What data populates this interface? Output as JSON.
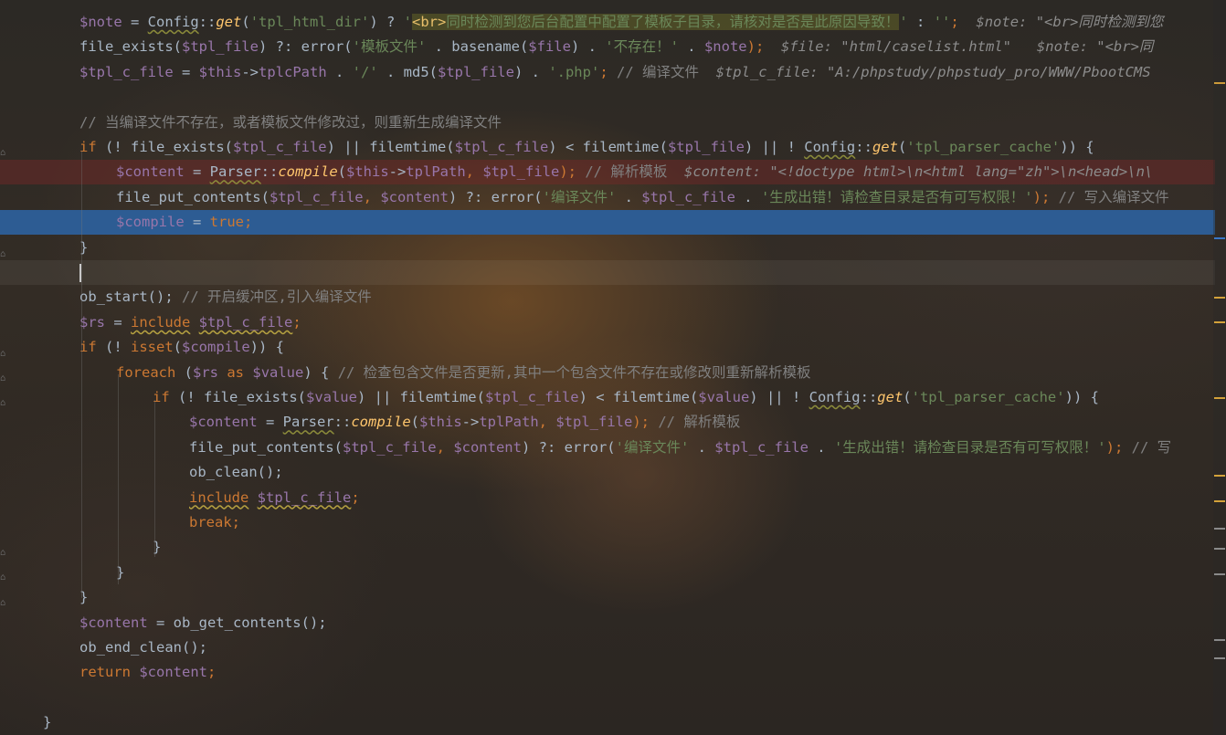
{
  "editor": {
    "lines": [
      {
        "segs": [
          [
            "$note",
            "v"
          ],
          [
            " = ",
            ""
          ],
          [
            "Config",
            "cls"
          ],
          [
            "::",
            ""
          ],
          [
            "get",
            "f"
          ],
          [
            "(",
            ""
          ],
          [
            "'tpl_html_dir'",
            "s"
          ],
          [
            ") ? ",
            ""
          ],
          [
            "'",
            "s"
          ],
          [
            "<br>",
            "tag"
          ],
          [
            "同时检测到您后台配置中配置了模板子目录，请核对是否是此原因导致！",
            "tagtext"
          ],
          [
            "'",
            "s"
          ],
          [
            " : ",
            ""
          ],
          [
            "''",
            "s"
          ],
          [
            ";",
            "p"
          ],
          [
            "  $note: \"<br>同时检测到您",
            "hint"
          ]
        ]
      },
      {
        "segs": [
          [
            "file_exists(",
            ""
          ],
          [
            "$tpl_file",
            "v"
          ],
          [
            ") ?: error(",
            ""
          ],
          [
            "'模板文件'",
            "s"
          ],
          [
            " . basename(",
            ""
          ],
          [
            "$file",
            "v"
          ],
          [
            ") . ",
            ""
          ],
          [
            "'不存在！'",
            "s"
          ],
          [
            " . ",
            ""
          ],
          [
            "$note",
            "v"
          ],
          [
            ");",
            "p"
          ],
          [
            "  $file: \"html/caselist.html\"   $note: \"<br>同",
            "hint"
          ]
        ]
      },
      {
        "segs": [
          [
            "$tpl_c_file",
            "v"
          ],
          [
            " = ",
            ""
          ],
          [
            "$this",
            "v"
          ],
          [
            "->",
            ""
          ],
          [
            "tplcPath",
            "v"
          ],
          [
            " . ",
            ""
          ],
          [
            "'/'",
            "s"
          ],
          [
            " . md5(",
            ""
          ],
          [
            "$tpl_file",
            "v"
          ],
          [
            ") . ",
            ""
          ],
          [
            "'.php'",
            "s"
          ],
          [
            "; ",
            "p"
          ],
          [
            "// 编译文件",
            "c"
          ],
          [
            "  $tpl_c_file: \"A:/phpstudy/phpstudy_pro/WWW/PbootCMS",
            "hint"
          ]
        ]
      },
      {
        "segs": []
      },
      {
        "segs": [
          [
            "// 当编译文件不存在，或者模板文件修改过，则重新生成编译文件",
            "c"
          ]
        ]
      },
      {
        "segs": [
          [
            "if",
            "k"
          ],
          [
            " (! file_exists(",
            ""
          ],
          [
            "$tpl_c_file",
            "v"
          ],
          [
            ") || filemtime(",
            ""
          ],
          [
            "$tpl_c_file",
            "v"
          ],
          [
            ") < filemtime(",
            ""
          ],
          [
            "$tpl_file",
            "v"
          ],
          [
            ") || ! ",
            ""
          ],
          [
            "Config",
            "cls"
          ],
          [
            "::",
            ""
          ],
          [
            "get",
            "f"
          ],
          [
            "(",
            ""
          ],
          [
            "'tpl_parser_cache'",
            "s"
          ],
          [
            ")) {",
            ""
          ]
        ]
      },
      {
        "segs": [
          [
            "$content",
            "v"
          ],
          [
            " = ",
            ""
          ],
          [
            "Parser",
            "cls"
          ],
          [
            "::",
            ""
          ],
          [
            "compile",
            "f"
          ],
          [
            "(",
            ""
          ],
          [
            "$this",
            "v"
          ],
          [
            "->",
            ""
          ],
          [
            "tplPath",
            "v"
          ],
          [
            ", ",
            "p"
          ],
          [
            "$tpl_file",
            "v"
          ],
          [
            "); ",
            "p"
          ],
          [
            "// 解析模板",
            "c"
          ],
          [
            "  $content: \"<!doctype html>\\n<html lang=\"zh\">\\n<head>\\n\\",
            "hint"
          ]
        ]
      },
      {
        "segs": [
          [
            "file_put_contents(",
            ""
          ],
          [
            "$tpl_c_file",
            "v"
          ],
          [
            ", ",
            "p"
          ],
          [
            "$content",
            "v"
          ],
          [
            ") ?: error(",
            ""
          ],
          [
            "'编译文件'",
            "s"
          ],
          [
            " . ",
            ""
          ],
          [
            "$tpl_c_file",
            "v"
          ],
          [
            " . ",
            ""
          ],
          [
            "'生成出错！请检查目录是否有可写权限！'",
            "s"
          ],
          [
            "); ",
            "p"
          ],
          [
            "// 写入编译文件",
            "c"
          ]
        ]
      },
      {
        "segs": [
          [
            "$compile",
            "v"
          ],
          [
            " = ",
            ""
          ],
          [
            "true",
            "k"
          ],
          [
            ";",
            "p"
          ]
        ]
      },
      {
        "segs": [
          [
            "}",
            ""
          ]
        ]
      },
      {
        "segs": []
      },
      {
        "segs": [
          [
            "ob_start(); ",
            ""
          ],
          [
            "// 开启缓冲区,引入编译文件",
            "c"
          ]
        ]
      },
      {
        "segs": [
          [
            "$rs",
            "v"
          ],
          [
            " = ",
            ""
          ],
          [
            "include",
            "uline k"
          ],
          [
            " ",
            ""
          ],
          [
            "$tpl_c_file",
            "uline v"
          ],
          [
            ";",
            "p"
          ]
        ]
      },
      {
        "segs": [
          [
            "if",
            "k"
          ],
          [
            " (! ",
            ""
          ],
          [
            "isset",
            "k"
          ],
          [
            "(",
            ""
          ],
          [
            "$compile",
            "v"
          ],
          [
            ")) {",
            ""
          ]
        ]
      },
      {
        "segs": [
          [
            "foreach",
            "k"
          ],
          [
            " (",
            ""
          ],
          [
            "$rs",
            "v"
          ],
          [
            " ",
            ""
          ],
          [
            "as",
            "k"
          ],
          [
            " ",
            ""
          ],
          [
            "$value",
            "v"
          ],
          [
            ") { ",
            ""
          ],
          [
            "// 检查包含文件是否更新,其中一个包含文件不存在或修改则重新解析模板",
            "c"
          ]
        ]
      },
      {
        "segs": [
          [
            "if",
            "k"
          ],
          [
            " (! file_exists(",
            ""
          ],
          [
            "$value",
            "v"
          ],
          [
            ") || filemtime(",
            ""
          ],
          [
            "$tpl_c_file",
            "v"
          ],
          [
            ") < filemtime(",
            ""
          ],
          [
            "$value",
            "v"
          ],
          [
            ") || ! ",
            ""
          ],
          [
            "Config",
            "cls"
          ],
          [
            "::",
            ""
          ],
          [
            "get",
            "f"
          ],
          [
            "(",
            ""
          ],
          [
            "'tpl_parser_cache'",
            "s"
          ],
          [
            ")) {",
            ""
          ]
        ]
      },
      {
        "segs": [
          [
            "$content",
            "v"
          ],
          [
            " = ",
            ""
          ],
          [
            "Parser",
            "cls"
          ],
          [
            "::",
            ""
          ],
          [
            "compile",
            "f"
          ],
          [
            "(",
            ""
          ],
          [
            "$this",
            "v"
          ],
          [
            "->",
            ""
          ],
          [
            "tplPath",
            "v"
          ],
          [
            ", ",
            "p"
          ],
          [
            "$tpl_file",
            "v"
          ],
          [
            "); ",
            "p"
          ],
          [
            "// 解析模板",
            "c"
          ]
        ]
      },
      {
        "segs": [
          [
            "file_put_contents(",
            ""
          ],
          [
            "$tpl_c_file",
            "v"
          ],
          [
            ", ",
            "p"
          ],
          [
            "$content",
            "v"
          ],
          [
            ") ?: error(",
            ""
          ],
          [
            "'编译文件'",
            "s"
          ],
          [
            " . ",
            ""
          ],
          [
            "$tpl_c_file",
            "v"
          ],
          [
            " . ",
            ""
          ],
          [
            "'生成出错！请检查目录是否有可写权限！'",
            "s"
          ],
          [
            "); ",
            "p"
          ],
          [
            "// 写",
            "c"
          ]
        ]
      },
      {
        "segs": [
          [
            "ob_clean();",
            ""
          ]
        ]
      },
      {
        "segs": [
          [
            "include",
            "uline k"
          ],
          [
            " ",
            ""
          ],
          [
            "$tpl_c_file",
            "uline v"
          ],
          [
            ";",
            "p"
          ]
        ]
      },
      {
        "segs": [
          [
            "break",
            "k"
          ],
          [
            ";",
            "p"
          ]
        ]
      },
      {
        "segs": [
          [
            "}",
            ""
          ]
        ]
      },
      {
        "segs": [
          [
            "}",
            ""
          ]
        ]
      },
      {
        "segs": [
          [
            "}",
            ""
          ]
        ]
      },
      {
        "segs": [
          [
            "$content",
            "v"
          ],
          [
            " = ob_get_contents();",
            ""
          ]
        ]
      },
      {
        "segs": [
          [
            "ob_end_clean();",
            ""
          ]
        ]
      },
      {
        "segs": [
          [
            "return",
            "k"
          ],
          [
            " ",
            ""
          ],
          [
            "$content",
            "v"
          ],
          [
            ";",
            "p"
          ]
        ]
      },
      {
        "segs": []
      },
      {
        "segs": [
          [
            "}",
            ""
          ]
        ]
      }
    ]
  },
  "colors": {
    "background": "#2b2b2b",
    "variable": "#9876aa",
    "keyword": "#cc7832",
    "string": "#6a8759",
    "comment": "#808080",
    "method": "#ffc66d",
    "selection": "#2d5c93",
    "breakpoint_line": "#5a2a2a"
  },
  "icons": [
    "fold-icon",
    "scrollbar-marker"
  ]
}
